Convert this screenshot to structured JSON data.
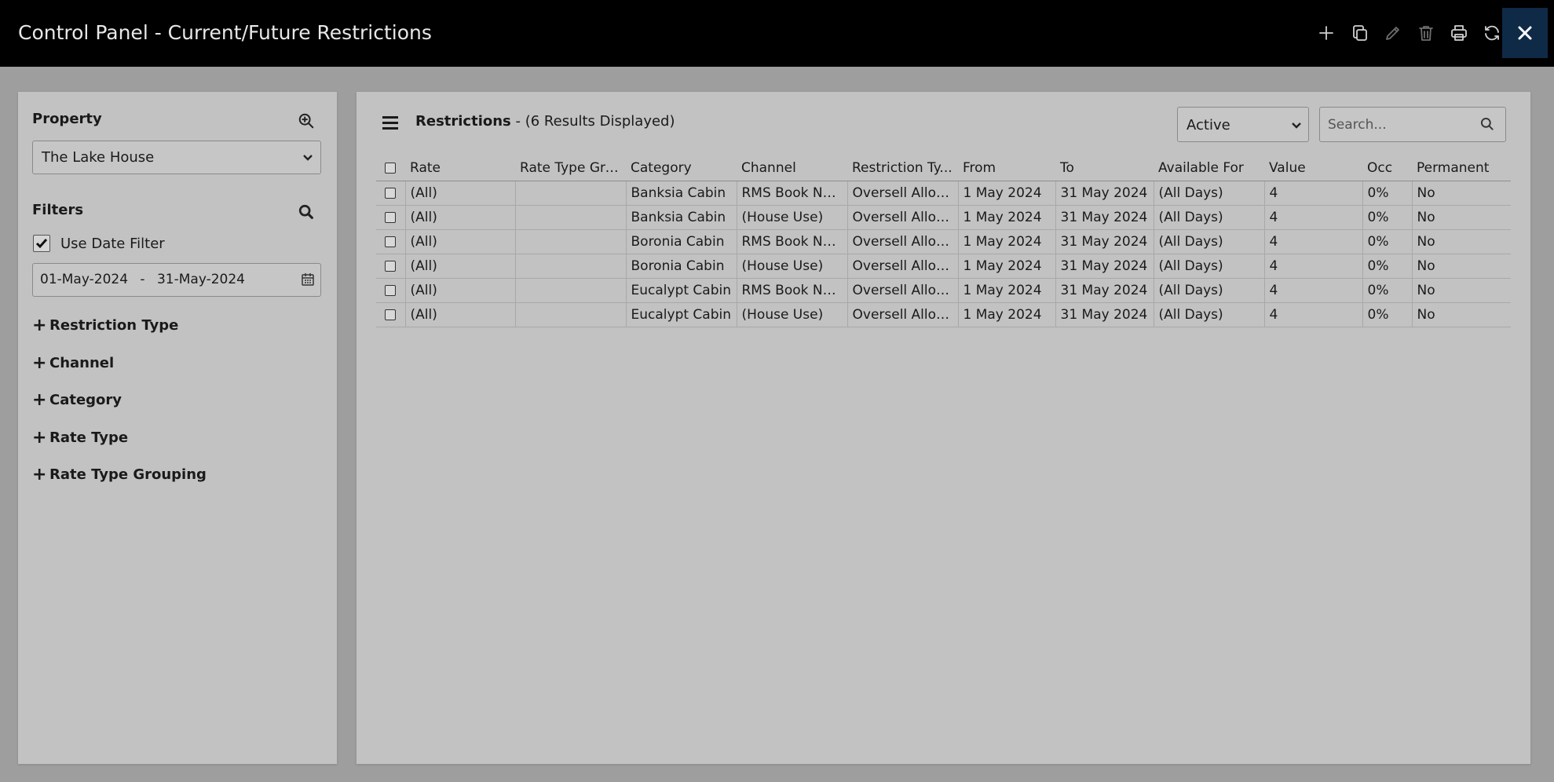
{
  "header": {
    "title": "Control Panel - Current/Future Restrictions",
    "icons": [
      "add-icon",
      "copy-icon",
      "edit-icon",
      "delete-icon",
      "print-icon",
      "refresh-icon",
      "close-icon"
    ]
  },
  "sidebar": {
    "property_label": "Property",
    "property_value": "The Lake House",
    "filters_label": "Filters",
    "use_date_filter_label": "Use Date Filter",
    "use_date_filter_checked": true,
    "date_from": "01-May-2024",
    "date_sep": "-",
    "date_to": "31-May-2024",
    "expanders": [
      "Restriction Type",
      "Channel",
      "Category",
      "Rate Type",
      "Rate Type Grouping"
    ]
  },
  "main": {
    "title_bold": "Restrictions",
    "title_rest": " - (6 Results Displayed)",
    "status_value": "Active",
    "search_placeholder": "Search...",
    "columns": [
      "Rate",
      "Rate Type Gro...",
      "Category",
      "Channel",
      "Restriction Ty...",
      "From",
      "To",
      "Available For",
      "Value",
      "Occ",
      "Permanent"
    ],
    "rows": [
      [
        "(All)",
        "",
        "Banksia Cabin",
        "RMS Book No...",
        "Oversell Allot...",
        "1 May 2024",
        "31 May 2024",
        "(All Days)",
        "4",
        "0%",
        "No"
      ],
      [
        "(All)",
        "",
        "Banksia Cabin",
        "(House Use)",
        "Oversell Allot...",
        "1 May 2024",
        "31 May 2024",
        "(All Days)",
        "4",
        "0%",
        "No"
      ],
      [
        "(All)",
        "",
        "Boronia Cabin",
        "RMS Book No...",
        "Oversell Allot...",
        "1 May 2024",
        "31 May 2024",
        "(All Days)",
        "4",
        "0%",
        "No"
      ],
      [
        "(All)",
        "",
        "Boronia Cabin",
        "(House Use)",
        "Oversell Allot...",
        "1 May 2024",
        "31 May 2024",
        "(All Days)",
        "4",
        "0%",
        "No"
      ],
      [
        "(All)",
        "",
        "Eucalypt Cabin",
        "RMS Book No...",
        "Oversell Allot...",
        "1 May 2024",
        "31 May 2024",
        "(All Days)",
        "4",
        "0%",
        "No"
      ],
      [
        "(All)",
        "",
        "Eucalypt Cabin",
        "(House Use)",
        "Oversell Allot...",
        "1 May 2024",
        "31 May 2024",
        "(All Days)",
        "4",
        "0%",
        "No"
      ]
    ]
  }
}
